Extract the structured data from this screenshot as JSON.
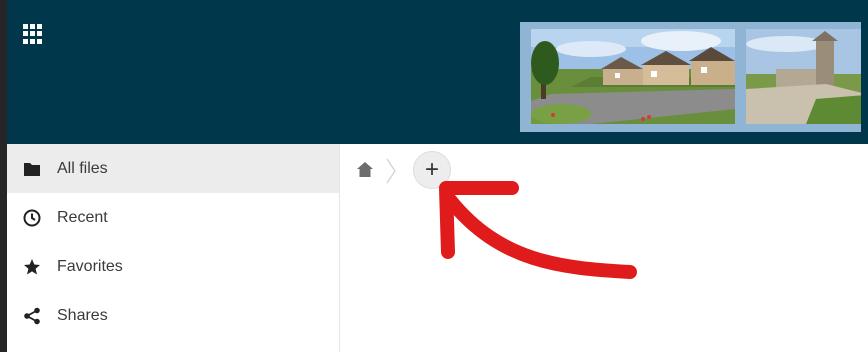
{
  "header": {
    "apps_icon": "apps-grid-icon",
    "background_color": "#01374b"
  },
  "sidebar": {
    "items": [
      {
        "label": "All files",
        "icon": "folder-icon",
        "active": true
      },
      {
        "label": "Recent",
        "icon": "clock-icon",
        "active": false
      },
      {
        "label": "Favorites",
        "icon": "star-icon",
        "active": false
      },
      {
        "label": "Shares",
        "icon": "share-icon",
        "active": false
      }
    ]
  },
  "breadcrumb": {
    "home_icon": "home-icon",
    "separator_icon": "chevron-right-icon"
  },
  "toolbar": {
    "add_label": "+"
  },
  "annotation": {
    "type": "red-arrow",
    "color": "#e01b1b",
    "points_to": "add-button"
  }
}
